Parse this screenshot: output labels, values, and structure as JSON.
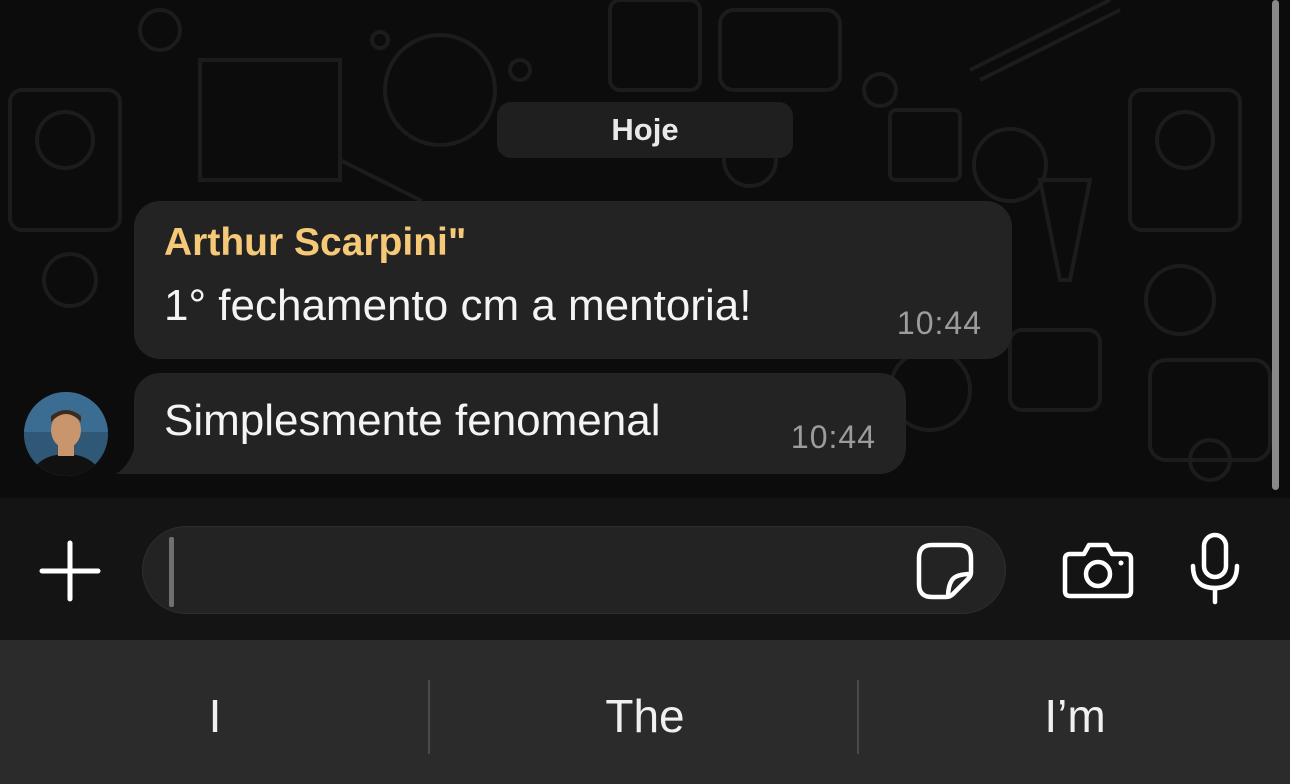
{
  "chat": {
    "date_label": "Hoje",
    "messages": [
      {
        "sender": "Arthur Scarpini\"",
        "text": "1° fechamento cm a mentoria!",
        "time": "10:44"
      },
      {
        "text": "Simplesmente fenomenal",
        "time": "10:44"
      }
    ]
  },
  "composer": {
    "input_value": "",
    "icons": {
      "attach": "plus-icon",
      "sticker": "sticker-icon",
      "camera": "camera-icon",
      "mic": "microphone-icon"
    }
  },
  "keyboard": {
    "suggestions": [
      "I",
      "The",
      "I’m"
    ]
  },
  "colors": {
    "sender_name": "#f5c978",
    "bubble": "#232323",
    "background": "#0c0c0c"
  }
}
